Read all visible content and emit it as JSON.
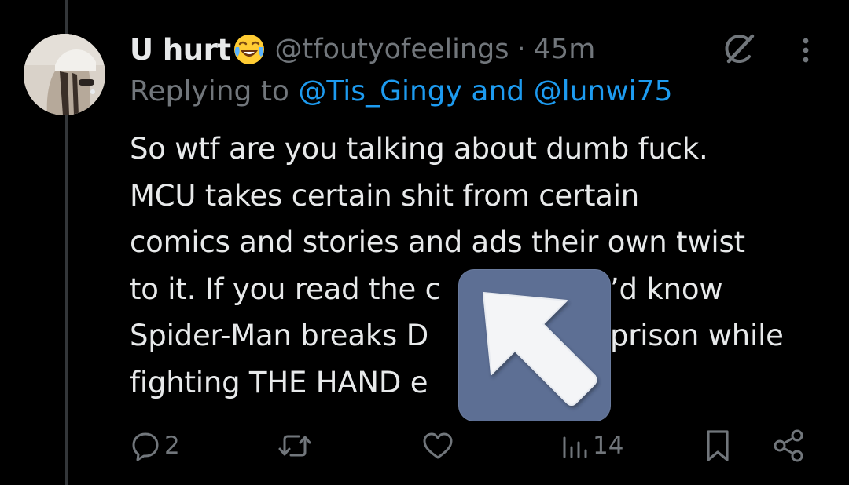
{
  "tweet": {
    "display_name": "U hurt",
    "name_emoji": "face-with-tears-of-joy",
    "handle": "@tfoutyofeelings",
    "separator": "·",
    "time_ago": "45m",
    "replying_prefix": "Replying to",
    "replying_to": [
      "@Tis_Gingy",
      "@lunwi75"
    ],
    "replying_joiner": "and",
    "text_lines": [
      "So wtf are you talking about dumb fuck.",
      "MCU takes certain shit from certain",
      "comics and stories and ads their own twist",
      "to it. If you read the c",
      "Spider-Man breaks D",
      "fighting THE HAND e"
    ],
    "text_lines_right": {
      "line4": "’d know",
      "line5": "prison while"
    }
  },
  "actions": {
    "reply_count": "2",
    "repost_count": "",
    "like_count": "",
    "views_count": "14"
  },
  "icons": {
    "grok": "grok-icon",
    "more": "more-dots-icon",
    "reply": "reply-bubble-icon",
    "repost": "repost-icon",
    "like": "heart-icon",
    "views": "views-bar-chart-icon",
    "bookmark": "bookmark-icon",
    "share": "share-icon",
    "overlay": "up-left-arrow-icon"
  },
  "colors": {
    "background": "#000000",
    "text": "#e7e9ea",
    "muted": "#71767b",
    "link": "#1d9bf0",
    "thread_line": "#333639",
    "overlay_box": "#5d6f94"
  }
}
